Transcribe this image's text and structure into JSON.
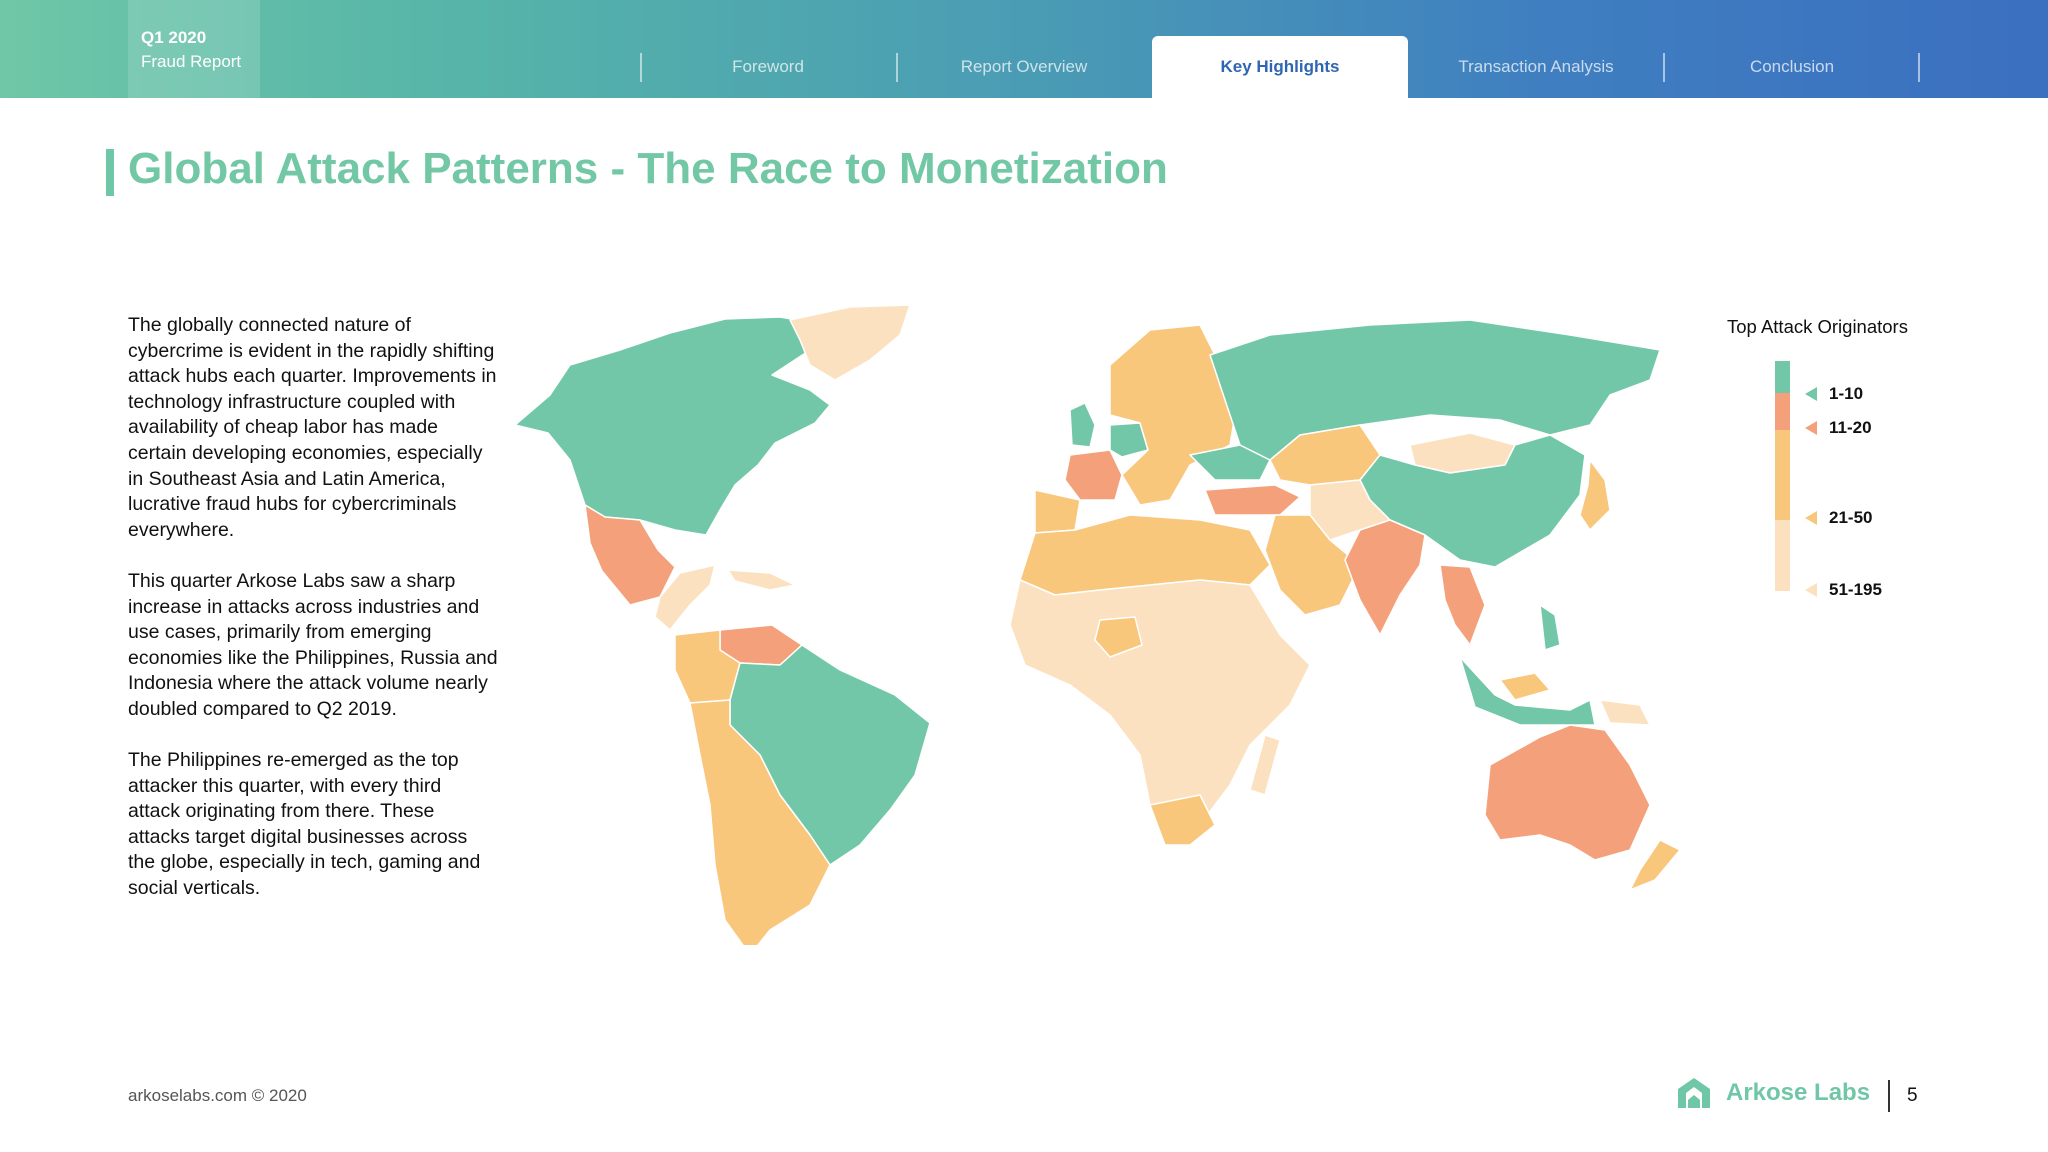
{
  "header": {
    "badge_quarter": "Q1 2020",
    "badge_title": "Fraud Report",
    "tabs": [
      {
        "label": "Foreword",
        "active": false
      },
      {
        "label": "Report Overview",
        "active": false
      },
      {
        "label": "Key Highlights",
        "active": true
      },
      {
        "label": "Transaction Analysis",
        "active": false
      },
      {
        "label": "Conclusion",
        "active": false
      }
    ]
  },
  "page": {
    "title": "Global Attack Patterns - The Race to Monetization"
  },
  "body": {
    "paragraphs": [
      "The globally connected nature of cybercrime is evident in the rapidly shifting attack hubs each quarter. Improvements in technology infrastructure coupled with availability of cheap labor has made certain developing economies, especially in Southeast Asia and Latin America, lucrative fraud hubs for cybercriminals everywhere.",
      "This quarter Arkose Labs saw a sharp increase in attacks across industries and use cases, primarily from emerging economies like the Philippines, Russia and Indonesia where the attack volume nearly doubled compared to Q2 2019.",
      "The Philippines re-emerged as the top attacker this quarter, with every third attack originating from there. These attacks target digital businesses across the globe, especially in tech, gaming and social verticals."
    ]
  },
  "legend": {
    "title": "Top Attack Originators",
    "items": [
      {
        "label": "1-10",
        "color": "#72c7a8"
      },
      {
        "label": "11-20",
        "color": "#f4a07b"
      },
      {
        "label": "21-50",
        "color": "#f9c77c"
      },
      {
        "label": "51-195",
        "color": "#fbe1c0"
      }
    ]
  },
  "map": {
    "regions": [
      {
        "name": "Canada / USA",
        "tier": "1-10"
      },
      {
        "name": "Greenland",
        "tier": "51-195"
      },
      {
        "name": "Mexico",
        "tier": "11-20"
      },
      {
        "name": "Central America & Caribbean",
        "tier": "51-195"
      },
      {
        "name": "Venezuela",
        "tier": "11-20"
      },
      {
        "name": "Colombia",
        "tier": "21-50"
      },
      {
        "name": "Brazil",
        "tier": "1-10"
      },
      {
        "name": "Peru / Chile / Argentina",
        "tier": "21-50"
      },
      {
        "name": "United Kingdom",
        "tier": "1-10"
      },
      {
        "name": "France",
        "tier": "11-20"
      },
      {
        "name": "Germany",
        "tier": "1-10"
      },
      {
        "name": "Iberia",
        "tier": "21-50"
      },
      {
        "name": "Scandinavia / Central & Eastern Europe",
        "tier": "21-50"
      },
      {
        "name": "Ukraine",
        "tier": "1-10"
      },
      {
        "name": "Turkey",
        "tier": "11-20"
      },
      {
        "name": "Russia",
        "tier": "1-10"
      },
      {
        "name": "Kazakhstan",
        "tier": "21-50"
      },
      {
        "name": "Mongolia",
        "tier": "51-195"
      },
      {
        "name": "China",
        "tier": "1-10"
      },
      {
        "name": "India",
        "tier": "11-20"
      },
      {
        "name": "Vietnam / Thailand",
        "tier": "11-20"
      },
      {
        "name": "Japan",
        "tier": "21-50"
      },
      {
        "name": "Philippines",
        "tier": "1-10"
      },
      {
        "name": "Indonesia",
        "tier": "1-10"
      },
      {
        "name": "Malaysia",
        "tier": "21-50"
      },
      {
        "name": "Middle East",
        "tier": "21-50"
      },
      {
        "name": "Central Asia",
        "tier": "51-195"
      },
      {
        "name": "North Africa",
        "tier": "21-50"
      },
      {
        "name": "Africa",
        "tier": "51-195"
      },
      {
        "name": "Nigeria",
        "tier": "21-50"
      },
      {
        "name": "South Africa",
        "tier": "21-50"
      },
      {
        "name": "Madagascar",
        "tier": "51-195"
      },
      {
        "name": "Papua New Guinea",
        "tier": "51-195"
      },
      {
        "name": "Australia",
        "tier": "11-20"
      },
      {
        "name": "New Zealand",
        "tier": "21-50"
      }
    ]
  },
  "footer": {
    "copyright": "arkoselabs.com © 2020",
    "brand": "Arkose Labs",
    "page_number": "5"
  },
  "colors": {
    "accent": "#72c7a5",
    "header_start": "#6fc7a7",
    "header_end": "#3b6fc0"
  }
}
